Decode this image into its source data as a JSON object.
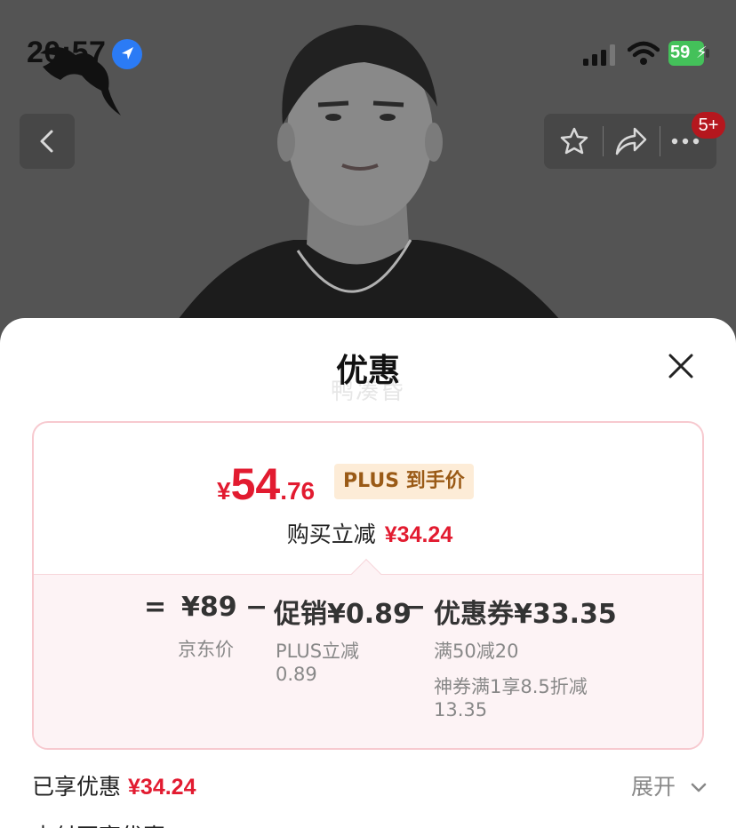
{
  "status_bar": {
    "time": "20:57",
    "battery_level": "59"
  },
  "nav": {
    "cart_badge": "5+"
  },
  "sheet": {
    "title": "优惠",
    "ghost_text": "鸭凑昏"
  },
  "price_card": {
    "currency": "¥",
    "price_integer": "54",
    "price_decimal": ".76",
    "price_tag": "PLUS 到手价",
    "instant_reduction_label": "购买立减",
    "instant_reduction_amount": "¥34.24"
  },
  "breakdown": {
    "equals": "=",
    "minus": "−",
    "items": [
      {
        "value": "¥89",
        "notes": [
          "京东价"
        ]
      },
      {
        "value": "促销¥0.89",
        "notes": [
          "PLUS立减",
          "0.89"
        ]
      },
      {
        "value": "优惠券¥33.35",
        "notes": [
          "满50减20",
          "神券满1享8.5折减",
          "13.35"
        ]
      }
    ]
  },
  "summary": {
    "enjoyed_label": "已享优惠",
    "enjoyed_amount": "¥34.24",
    "expand_label": "展开",
    "next_row_label": "支付再享优惠"
  },
  "colors": {
    "accent_red": "#e21b30",
    "card_border": "#f7c9cf",
    "plus_tag_bg": "#fdecd7",
    "plus_tag_text": "#9a5a16"
  }
}
